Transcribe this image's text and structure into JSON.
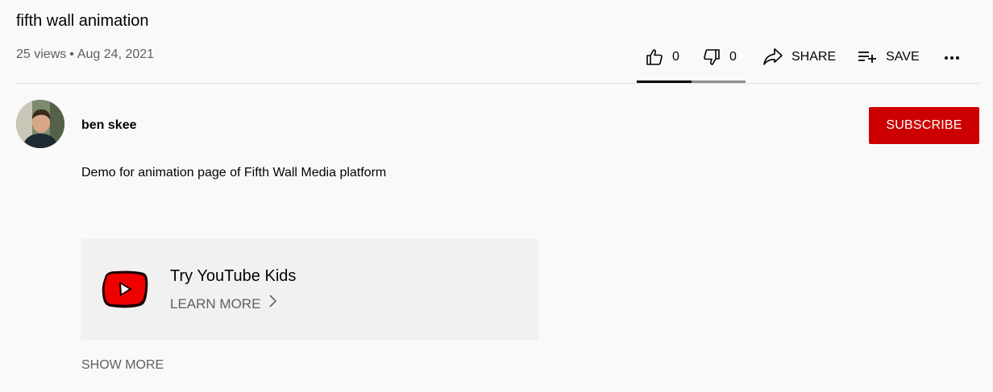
{
  "video": {
    "title": "fifth wall animation",
    "views": "25 views",
    "separator": "•",
    "date": "Aug 24, 2021"
  },
  "actions": {
    "like_icon": "thumbs-up-icon",
    "like_count": "0",
    "dislike_icon": "thumbs-down-icon",
    "dislike_count": "0",
    "share_icon": "share-arrow-icon",
    "share_label": "SHARE",
    "save_icon": "playlist-add-icon",
    "save_label": "SAVE",
    "more_icon": "more-horizontal-icon",
    "like_ratio": 0.5
  },
  "channel": {
    "name": "ben skee",
    "avatar_icon": "avatar-photo",
    "subscribe_label": "SUBSCRIBE",
    "subscribe_color": "#cc0000"
  },
  "description": {
    "text": "Demo for animation page of Fifth Wall Media platform"
  },
  "kids_promo": {
    "logo_icon": "youtube-kids-logo-icon",
    "title": "Try YouTube Kids",
    "learn_more": "LEARN MORE",
    "chevron_icon": "chevron-right-icon"
  },
  "show_more": "SHOW MORE",
  "colors": {
    "background": "#f9f9f9",
    "card": "#f1f1f1",
    "secondary_text": "#606060",
    "brand_red": "#cc0000"
  }
}
